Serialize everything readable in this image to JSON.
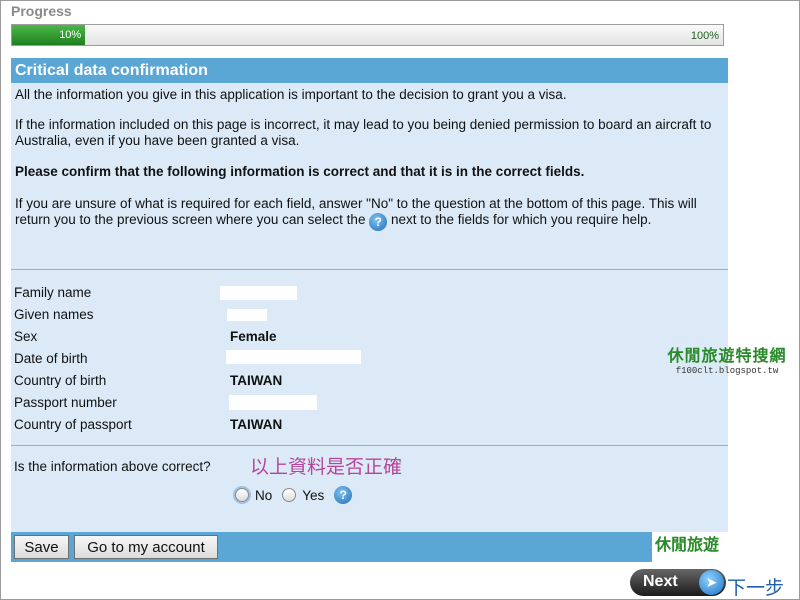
{
  "progress": {
    "title": "Progress",
    "fill_fraction": 0.103,
    "start_label": "10%",
    "end_label": "100%"
  },
  "section": {
    "title": "Critical data confirmation",
    "para1": "All the information you give in this application is important to the decision to grant you a visa.",
    "para2": "If the information included on this page is incorrect, it may lead to you being denied permission to board an aircraft to Australia, even if you have been granted a visa.",
    "para3": "Please confirm that the following information is correct and that it is in the correct fields.",
    "para4_before": "If you are unsure of what is required for each field, answer \"No\" to the question at the bottom of this page. This will return you to the previous screen where you can select the",
    "para4_after": "next to the fields for which you require help."
  },
  "fields": {
    "family_name": {
      "label": "Family name",
      "value": ""
    },
    "given_names": {
      "label": "Given names",
      "value": ""
    },
    "sex": {
      "label": "Sex",
      "value": "Female"
    },
    "date_of_birth": {
      "label": "Date of birth",
      "value": ""
    },
    "country_of_birth": {
      "label": "Country of birth",
      "value": "TAIWAN"
    },
    "passport_number": {
      "label": "Passport number",
      "value": ""
    },
    "country_of_passport": {
      "label": "Country of passport",
      "value": "TAIWAN"
    }
  },
  "question": {
    "text": "Is the information above correct?",
    "annotation": "以上資料是否正確",
    "option_no": "No",
    "option_yes": "Yes"
  },
  "buttons": {
    "save": "Save",
    "account": "Go to my account",
    "next": "Next",
    "next_annotation": "下一步"
  },
  "watermark": {
    "title": "休閒旅遊特搜網",
    "url": "f100clt.blogspot.tw",
    "bottom": "休閒旅遊"
  },
  "colors": {
    "header_blue": "#5aa6d4",
    "panel_bg": "#dbeaf6",
    "progress_green": "#2e9a2e"
  },
  "icons": {
    "help": "help-question-icon",
    "next_arrow": "arrow-right-circle-icon"
  }
}
